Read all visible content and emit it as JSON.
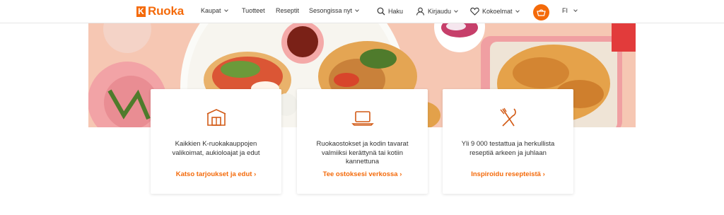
{
  "header": {
    "logo_letter": "K",
    "logo_text": "Ruoka",
    "nav": [
      {
        "label": "Kaupat",
        "has_dropdown": true
      },
      {
        "label": "Tuotteet",
        "has_dropdown": false
      },
      {
        "label": "Reseptit",
        "has_dropdown": false
      },
      {
        "label": "Sesongissa nyt",
        "has_dropdown": true
      }
    ],
    "search_label": "Haku",
    "login_label": "Kirjaudu",
    "collections_label": "Kokoelmat",
    "language": "FI",
    "icons": {
      "search": "search-icon",
      "user": "user-icon",
      "heart": "heart-icon",
      "cart": "basket-icon"
    }
  },
  "hero": {
    "image": "food-photo"
  },
  "cards": [
    {
      "icon": "store-icon",
      "description": "Kaikkien K-ruokakauppojen valikoimat, aukioloajat ja edut",
      "link": "Katso tarjoukset ja edut ›"
    },
    {
      "icon": "laptop-icon",
      "description": "Ruokaostokset ja kodin tavarat valmiiksi kerättynä tai kotiin kannettuna",
      "link": "Tee ostoksesi verkossa ›"
    },
    {
      "icon": "fork-knife-icon",
      "description": "Yli 9 000 testattua ja herkullista reseptiä arkeen ja juhlaan",
      "link": "Inspiroidu resepteistä ›"
    }
  ],
  "colors": {
    "brand": "#f46a0a",
    "hero_bg": "#f5c8b5"
  }
}
